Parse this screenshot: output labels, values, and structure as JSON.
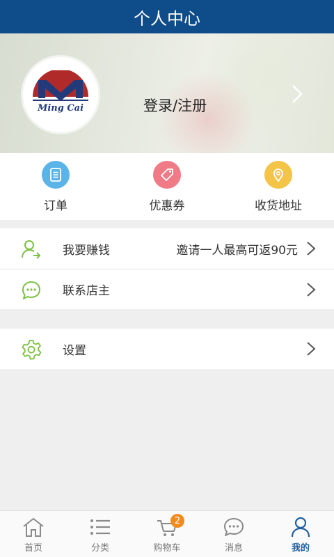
{
  "header": {
    "title": "个人中心"
  },
  "profile": {
    "login_label": "登录/注册",
    "logo_text": "Ming Cai"
  },
  "quick_actions": [
    {
      "label": "订单",
      "icon": "order-list-icon",
      "color": "#5bb4e8"
    },
    {
      "label": "优惠券",
      "icon": "coupon-tag-icon",
      "color": "#f07a86"
    },
    {
      "label": "收货地址",
      "icon": "location-pin-icon",
      "color": "#f3c447"
    }
  ],
  "menu": [
    {
      "label": "我要赚钱",
      "extra": "邀请一人最高可返90元",
      "icon": "user-share-icon"
    },
    {
      "label": "联系店主",
      "extra": "",
      "icon": "chat-bubble-icon"
    },
    {
      "label": "设置",
      "extra": "",
      "icon": "gear-icon"
    }
  ],
  "tabs": [
    {
      "label": "首页",
      "icon": "home-icon",
      "active": false
    },
    {
      "label": "分类",
      "icon": "list-icon",
      "active": false
    },
    {
      "label": "购物车",
      "icon": "cart-icon",
      "active": false,
      "badge": "2"
    },
    {
      "label": "消息",
      "icon": "message-icon",
      "active": false
    },
    {
      "label": "我的",
      "icon": "profile-icon",
      "active": true
    }
  ],
  "colors": {
    "header_bg": "#0f4c8a",
    "accent_green": "#7ac143",
    "active_tab": "#1f5fa0",
    "badge": "#f08c1e"
  }
}
